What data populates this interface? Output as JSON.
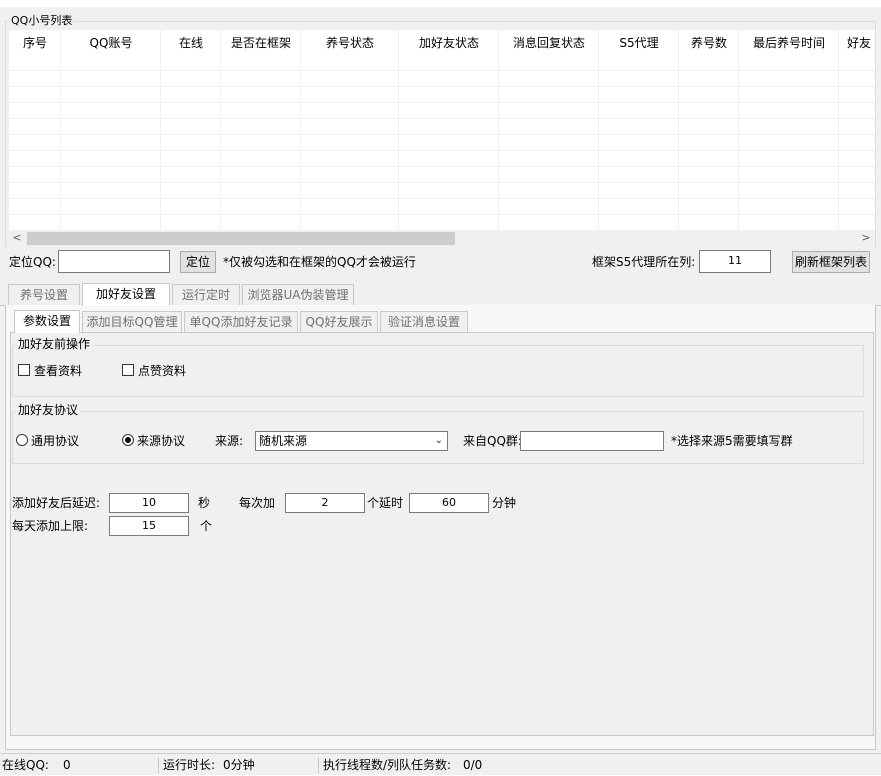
{
  "account_list": {
    "title": "QQ小号列表",
    "columns": [
      "序号",
      "QQ账号",
      "在线",
      "是否在框架",
      "养号状态",
      "加好友状态",
      "消息回复状态",
      "S5代理",
      "养号数",
      "最后养号时间",
      "好友"
    ],
    "rows": []
  },
  "scroll": {
    "left_arrow": "<",
    "right_arrow": ">"
  },
  "locate": {
    "label": "定位QQ:",
    "value": "",
    "button": "定位",
    "note": "*仅被勾选和在框架的QQ才会被运行",
    "proxy_col_label": "框架S5代理所在列:",
    "proxy_col_value": "11",
    "refresh_button": "刷新框架列表"
  },
  "main_tabs": [
    "养号设置",
    "加好友设置",
    "运行定时",
    "浏览器UA伪装管理"
  ],
  "main_tab_active": 1,
  "sub_tabs": [
    "参数设置",
    "添加目标QQ管理",
    "单QQ添加好友记录",
    "QQ好友展示",
    "验证消息设置"
  ],
  "sub_tab_active": 0,
  "pre_actions": {
    "title": "加好友前操作",
    "view_profile": {
      "label": "查看资料",
      "checked": false
    },
    "like_profile": {
      "label": "点赞资料",
      "checked": false
    }
  },
  "protocol": {
    "title": "加好友协议",
    "general": {
      "label": "通用协议",
      "selected": false
    },
    "source": {
      "label": "来源协议",
      "selected": true
    },
    "source_label": "来源:",
    "source_value": "随机来源",
    "group_label": "来自QQ群:",
    "group_value": "",
    "group_note": "*选择来源5需要填写群"
  },
  "delay": {
    "after_add_label": "添加好友后延迟:",
    "after_add_value": "10",
    "sec_unit": "秒",
    "each_label": "每次加",
    "each_value": "2",
    "each_unit": "个延时",
    "delay_value": "60",
    "min_unit": "分钟",
    "daily_label": "每天添加上限:",
    "daily_value": "15",
    "daily_unit": "个"
  },
  "status_bar": {
    "online_label": "在线QQ:",
    "online_value": "0",
    "runtime_label": "运行时长:",
    "runtime_value": "0分钟",
    "threads_label": "执行线程数/列队任务数:",
    "threads_value": "0/0"
  }
}
